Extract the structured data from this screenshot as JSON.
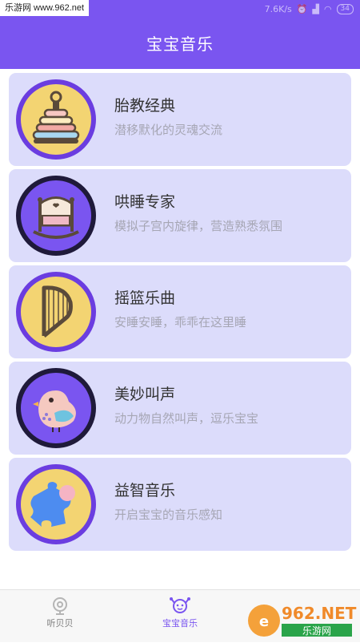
{
  "status_bar": {
    "watermark": "乐游网 www.962.net",
    "speed": "7.6K/s",
    "battery": "34"
  },
  "header": {
    "title": "宝宝音乐"
  },
  "items": [
    {
      "title": "胎教经典",
      "subtitle": "潜移默化的灵魂交流",
      "icon": "stacking-rings-icon"
    },
    {
      "title": "哄睡专家",
      "subtitle": "模拟子宫内旋律，营造熟悉氛围",
      "icon": "crib-icon"
    },
    {
      "title": "摇篮乐曲",
      "subtitle": "安睡安睡，乖乖在这里睡",
      "icon": "harp-icon"
    },
    {
      "title": "美妙叫声",
      "subtitle": "动力物自然叫声，逗乐宝宝",
      "icon": "bird-icon"
    },
    {
      "title": "益智音乐",
      "subtitle": "开启宝宝的音乐感知",
      "icon": "puzzle-icon"
    }
  ],
  "tabs": [
    {
      "label": "听贝贝",
      "icon": "listen-icon",
      "active": false
    },
    {
      "label": "宝宝音乐",
      "icon": "baby-music-icon",
      "active": true
    }
  ],
  "watermark_bottom": {
    "logo": "962.NET",
    "text": "乐游网"
  },
  "colors": {
    "primary": "#7a55f0",
    "card_bg": "#dcdcfb",
    "icon_gold": "#f3d472",
    "icon_purple": "#6b3de0"
  }
}
